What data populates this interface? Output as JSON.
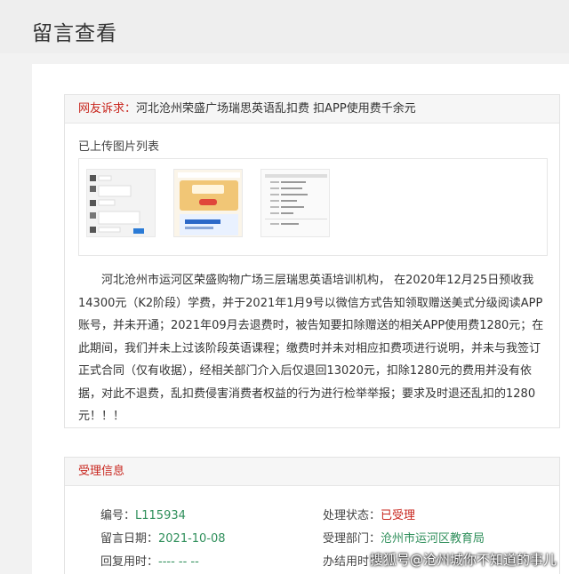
{
  "page": {
    "title": "留言查看"
  },
  "complaint": {
    "prefix": "网友诉求：",
    "subject": "河北沧州荣盛广场瑞思英语乱扣费 扣APP使用费千余元",
    "images_label": "已上传图片列表",
    "body": "河北沧州市运河区荣盛购物广场三层瑞思英语培训机构， 在2020年12月25日预收我14300元（K2阶段）学费，并于2021年1月9号以微信方式告知领取赠送美式分级阅读APP账号，并未开通；2021年09月去退费时，被告知要扣除赠送的相关APP使用费1280元；在此期间，我们并未上过该阶段英语课程；缴费时并未对相应扣费项进行说明，并未与我签订正式合同（仅有收据），经相关部门介入后仅退回13020元，扣除1280元的费用并没有依据，对此不退费，乱扣费侵害消费者权益的行为进行检举举报；要求及时退还乱扣的1280元！！！"
  },
  "acceptance": {
    "title": "受理信息",
    "number_label": "编号：",
    "number_value": "L115934",
    "status_label": "处理状态：",
    "status_value": "已受理",
    "date_label": "留言日期：",
    "date_value": "2021-10-08",
    "dept_label": "受理部门：",
    "dept_value": "沧州市运河区教育局",
    "reply_label": "回复用时：",
    "reply_value": "---- -- --",
    "finish_label": "办结用时："
  },
  "watermark": "搜狐号@沧州城你不知道的事儿",
  "colors": {
    "accent_red": "#c8261e",
    "accent_green": "#2f8f5b"
  }
}
